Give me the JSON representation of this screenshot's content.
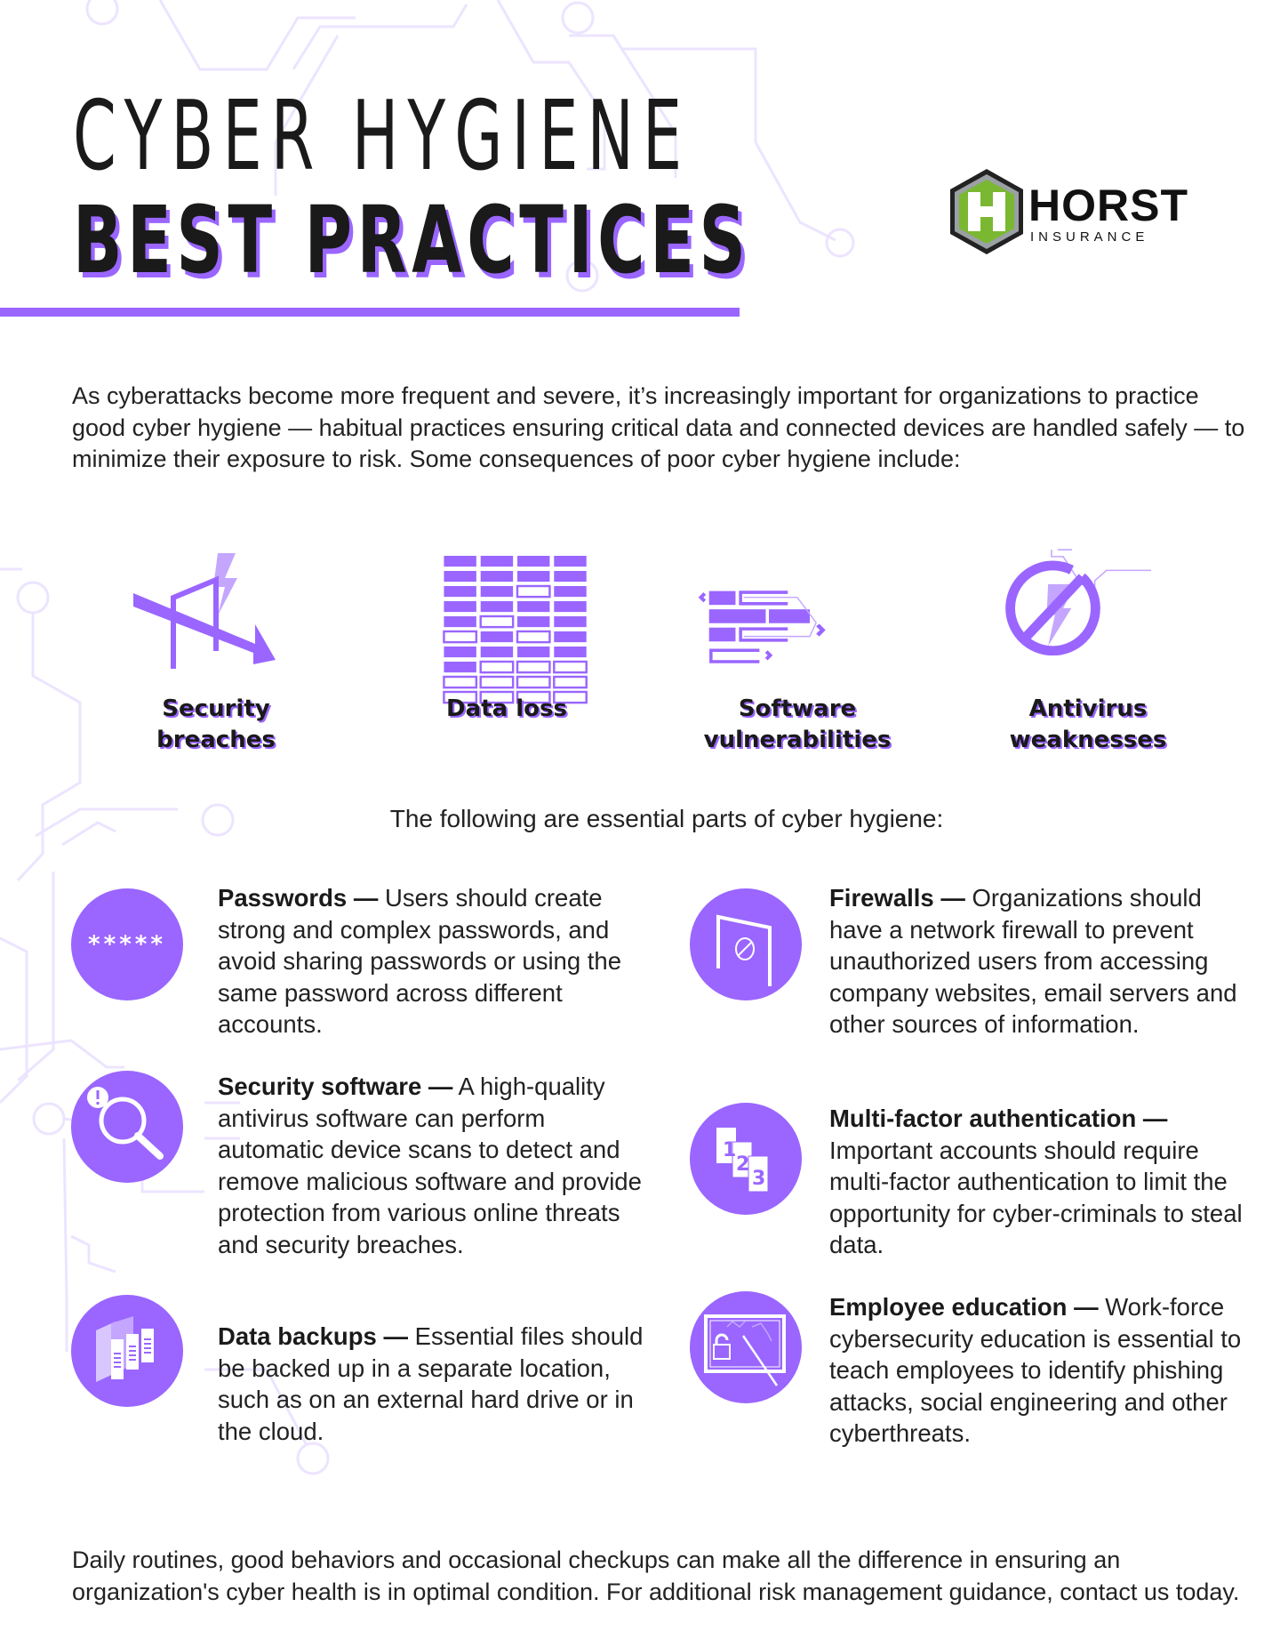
{
  "header": {
    "title_line1": "CYBER HYGIENE",
    "title_line2": "BEST PRACTICES"
  },
  "logo": {
    "brand": "HORST",
    "subtitle": "INSURANCE",
    "emblem_letter": "H"
  },
  "colors": {
    "accent": "#9a66ff",
    "accent_light": "#c4a6ff",
    "circuit": "#ece4ff",
    "logo_green": "#7bb832",
    "text": "#1d1d1d"
  },
  "intro": "As cyberattacks become more frequent and severe, it’s increasingly important for organizations to practice good cyber hygiene — habitual practices ensuring critical data and connected devices are handled safely — to minimize their exposure to risk. Some consequences of poor cyber hygiene include:",
  "consequences": [
    {
      "label": "Security breaches",
      "icon": "broken-fence-lightning-icon"
    },
    {
      "label": "Data loss",
      "icon": "data-grid-icon"
    },
    {
      "label": "Software vulnerabilities",
      "icon": "code-blocks-icon"
    },
    {
      "label": "Antivirus weaknesses",
      "icon": "no-lightning-icon"
    }
  ],
  "subheading": "The following are essential parts of cyber hygiene:",
  "practices": [
    {
      "title": "Passwords —",
      "body": " Users should create strong and complex passwords, and avoid sharing passwords or using the same password across different accounts.",
      "icon": "password-asterisks-icon",
      "icon_text": "*****"
    },
    {
      "title": "Security software —",
      "body": " A high-quality antivirus software can perform automatic device scans to detect and remove malicious software and provide protection from various online threats and security breaches.",
      "icon": "magnifier-alert-icon"
    },
    {
      "title": "Data backups —",
      "body": " Essential files should be backed up in a separate location, such as on an external hard drive or in the cloud.",
      "icon": "servers-icon"
    },
    {
      "title": "Firewalls —",
      "body": " Organizations should have a network firewall to prevent unauthorized users from accessing company websites, email servers and other sources of information.",
      "icon": "firewall-door-icon"
    },
    {
      "title": "Multi-factor authentication —",
      "body": " Important accounts should require multi-factor authentication to limit the opportunity for cyber-criminals to steal data.",
      "icon": "numbered-cards-icon",
      "icon_digits": [
        "1",
        "2",
        "3"
      ]
    },
    {
      "title": "Employee education —",
      "body": " Work-force cybersecurity education is essential to teach employees to identify phishing attacks, social engineering and other cyberthreats.",
      "icon": "presentation-board-lock-icon"
    }
  ],
  "footer": "Daily routines, good behaviors and occasional checkups can make all the difference in ensuring an organization's cyber health is in optimal condition. For additional risk management guidance, contact us today."
}
